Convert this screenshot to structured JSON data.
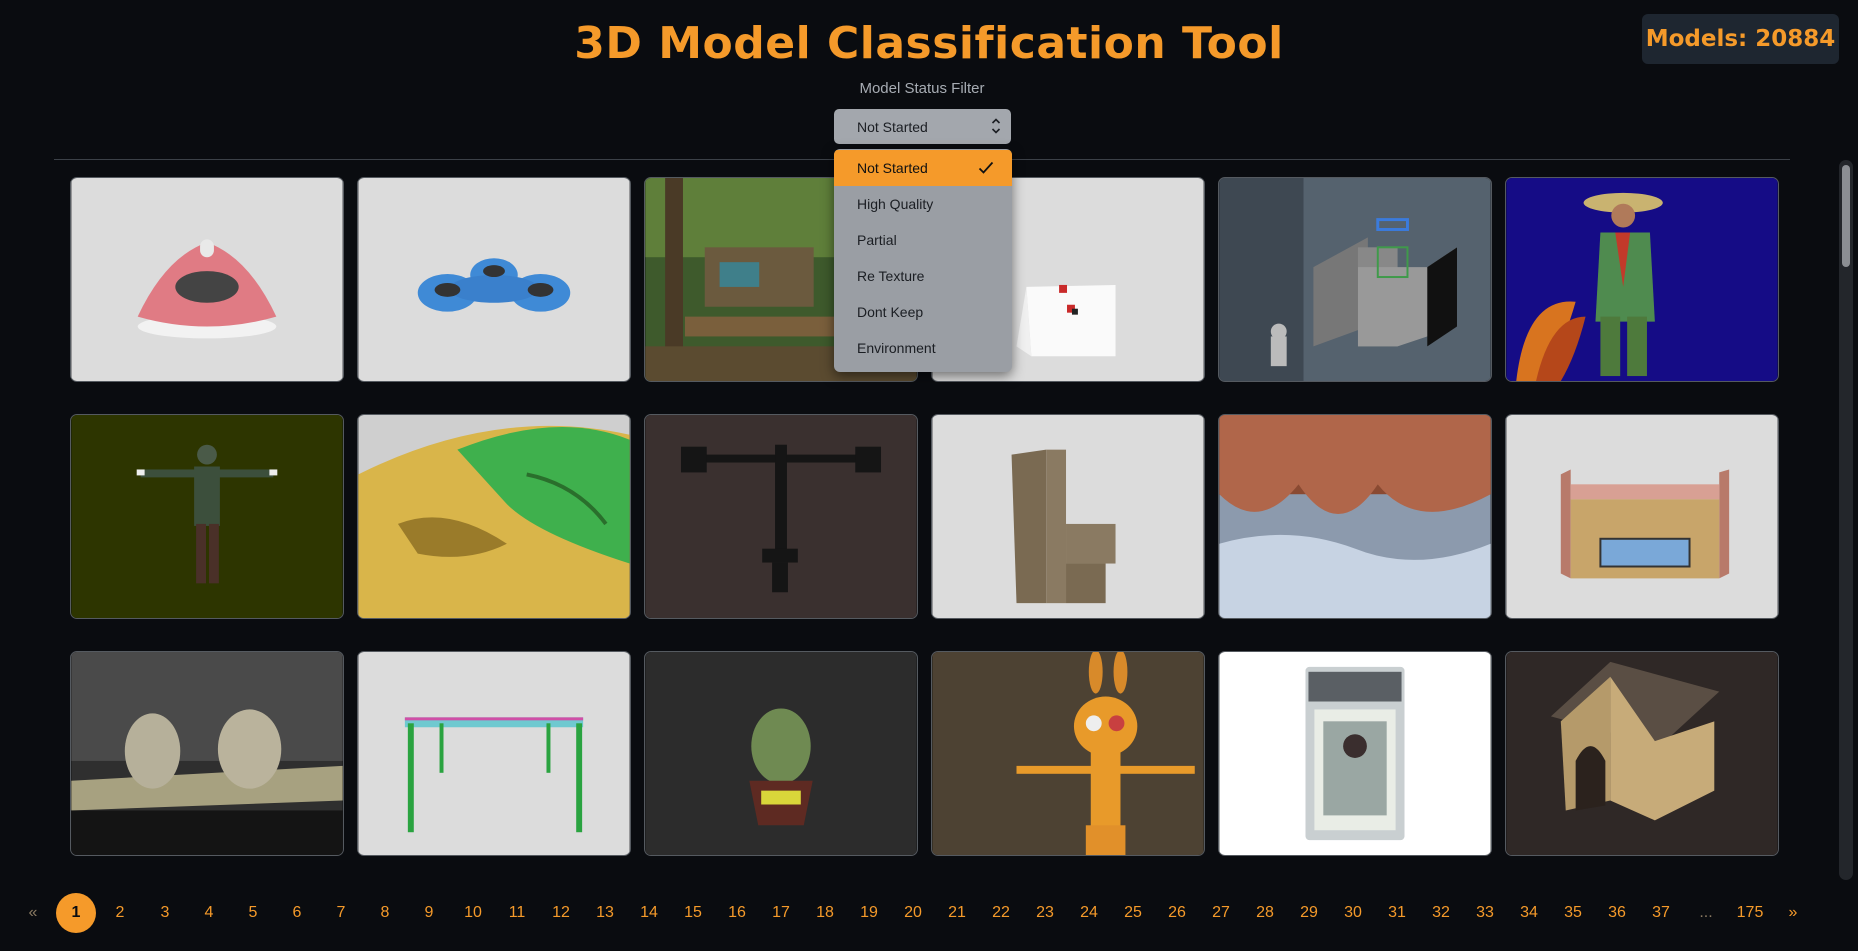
{
  "header": {
    "title": "3D Model Classification Tool",
    "models_count": "Models: 20884"
  },
  "filter": {
    "label": "Model Status Filter",
    "selected": "Not Started",
    "options": [
      "Not Started",
      "High Quality",
      "Partial",
      "Re Texture",
      "Dont Keep",
      "Environment"
    ]
  },
  "grid": {
    "thumbnails": [
      "pink-hovercraft",
      "blue-fidget-spinner",
      "jungle-treehouse",
      "white-scene-red-objects",
      "industrial-machine-diagram",
      "scarecrow-with-rooster",
      "soldier-t-pose",
      "terrain-heightmap",
      "dual-monitor-mount",
      "wooden-cabinet",
      "cave-interior",
      "small-house",
      "two-rocks-scan",
      "green-table-frame",
      "lizard-bust",
      "cartoon-cat-character",
      "graded-baseball-card",
      "wooden-doghouse"
    ]
  },
  "pagination": {
    "prev": "«",
    "pages": [
      "1",
      "2",
      "3",
      "4",
      "5",
      "6",
      "7",
      "8",
      "9",
      "10",
      "11",
      "12",
      "13",
      "14",
      "15",
      "16",
      "17",
      "18",
      "19",
      "20",
      "21",
      "22",
      "23",
      "24",
      "25",
      "26",
      "27",
      "28",
      "29",
      "30",
      "31",
      "32",
      "33",
      "34",
      "35",
      "36",
      "37"
    ],
    "ellipsis": "...",
    "last": "175",
    "next": "»",
    "current": "1"
  },
  "colors": {
    "accent": "#f59a2a",
    "background": "#0a0c10"
  }
}
